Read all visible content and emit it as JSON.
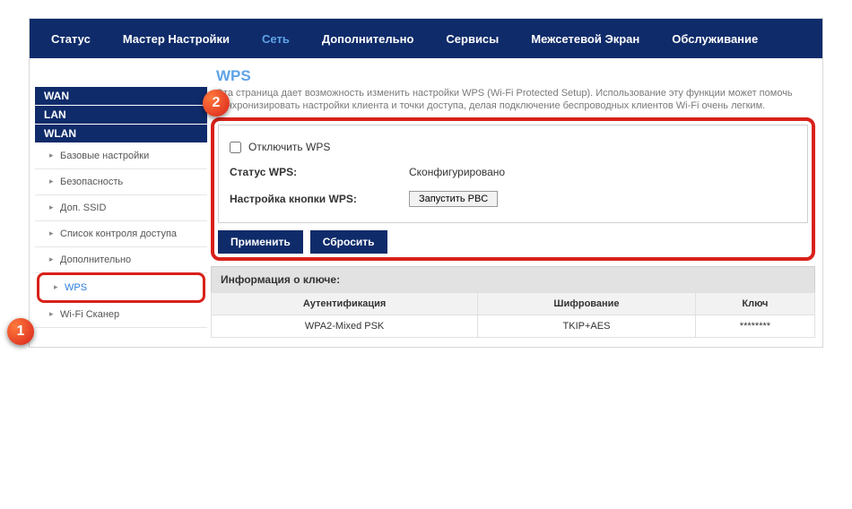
{
  "nav": {
    "status": "Статус",
    "wizard": "Мастер Настройки",
    "network": "Сеть",
    "advanced": "Дополнительно",
    "services": "Сервисы",
    "firewall": "Межсетевой Экран",
    "maintenance": "Обслуживание"
  },
  "sidebar": {
    "wan": "WAN",
    "lan": "LAN",
    "wlan": "WLAN",
    "items": [
      {
        "label": "Базовые настройки"
      },
      {
        "label": "Безопасность"
      },
      {
        "label": "Доп. SSID"
      },
      {
        "label": "Список контроля доступа"
      },
      {
        "label": "Дополнительно"
      },
      {
        "label": "WPS"
      },
      {
        "label": "Wi-Fi Сканер"
      }
    ]
  },
  "page": {
    "title": "WPS",
    "desc": "Эта страница дает возможность изменить настройки WPS (Wi-Fi Protected Setup). Использование эту функции может помочь синхронизировать настройки клиента и точки доступа, делая подключение беспроводных клиентов Wi-Fi очень легким."
  },
  "form": {
    "disable_label": "Отключить WPS",
    "status_label": "Статус WPS:",
    "status_value": "Сконфигурировано",
    "pbc_label": "Настройка кнопки WPS:",
    "pbc_button": "Запустить PBC",
    "apply": "Применить",
    "reset": "Сбросить"
  },
  "keyinfo": {
    "title": "Информация о ключе:",
    "headers": {
      "auth": "Аутентификация",
      "enc": "Шифрование",
      "key": "Ключ"
    },
    "row": {
      "auth": "WPA2-Mixed PSK",
      "enc": "TKIP+AES",
      "key": "********"
    }
  },
  "callouts": {
    "c1": "1",
    "c2": "2"
  }
}
